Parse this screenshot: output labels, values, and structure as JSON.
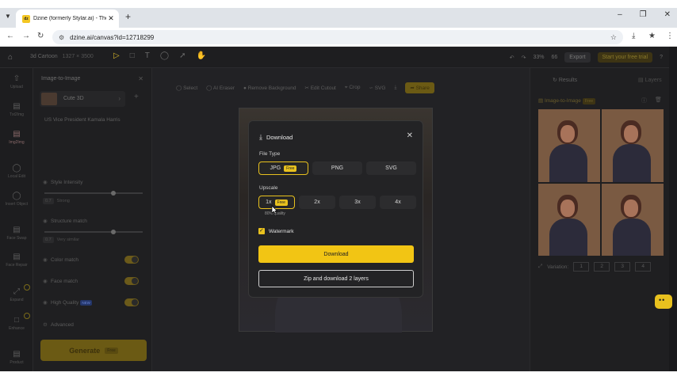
{
  "browser": {
    "tab_title": "Dzine (formerly Stylar.ai) - The",
    "favicon_text": "dz",
    "url": "dzine.ai/canvas?id=12718299"
  },
  "app": {
    "project_name": "3d Cartoon",
    "project_dims": "1327 × 3500",
    "zoom": "33%",
    "credits": "66",
    "export_label": "Export",
    "trial_label": "Start your free trial"
  },
  "leftbar": {
    "items": [
      "Upload",
      "Txt2Img",
      "Img2Img",
      "Local Edit",
      "Insert Object",
      "Face Swap",
      "Face Repair",
      "Expand",
      "Enhance",
      "Product"
    ]
  },
  "panel": {
    "title": "Image-to-Image",
    "style_name": "Cute 3D",
    "prompt": "US Vice President Kamala Harris",
    "style_intensity_label": "Style Intensity",
    "style_intensity_chip": "0.7",
    "style_intensity_value": "Strong",
    "structure_match_label": "Structure match",
    "structure_match_chip": "0.7",
    "structure_match_value": "Very similar",
    "color_match_label": "Color match",
    "face_match_label": "Face match",
    "high_quality_label": "High Quality",
    "new_badge": "NEW",
    "advanced_label": "Advanced",
    "generate_label": "Generate",
    "generate_badge": "Free"
  },
  "canvas_toolbar": {
    "select": "Select",
    "ai_eraser": "AI Eraser",
    "remove_bg": "Remove Background",
    "edit_cutout": "Edit Cutout",
    "crop": "Crop",
    "svg": "SVG",
    "share": "Share"
  },
  "results": {
    "tab_results": "Results",
    "tab_layers": "Layers",
    "header": "Image-to-Image",
    "header_badge": "Free",
    "variation_label": "Variation:",
    "variations": [
      "1",
      "2",
      "3",
      "4"
    ]
  },
  "modal": {
    "title": "Download",
    "file_type_label": "File Type",
    "file_types": [
      "JPG",
      "PNG",
      "SVG"
    ],
    "free_badge": "Free",
    "upscale_label": "Upscale",
    "upscales": [
      "1x",
      "2x",
      "3x",
      "4x"
    ],
    "quality_note": "80% quality",
    "watermark_label": "Watermark",
    "download_label": "Download",
    "zip_label": "Zip and download 2 layers"
  },
  "colors": {
    "accent": "#f2c514"
  }
}
